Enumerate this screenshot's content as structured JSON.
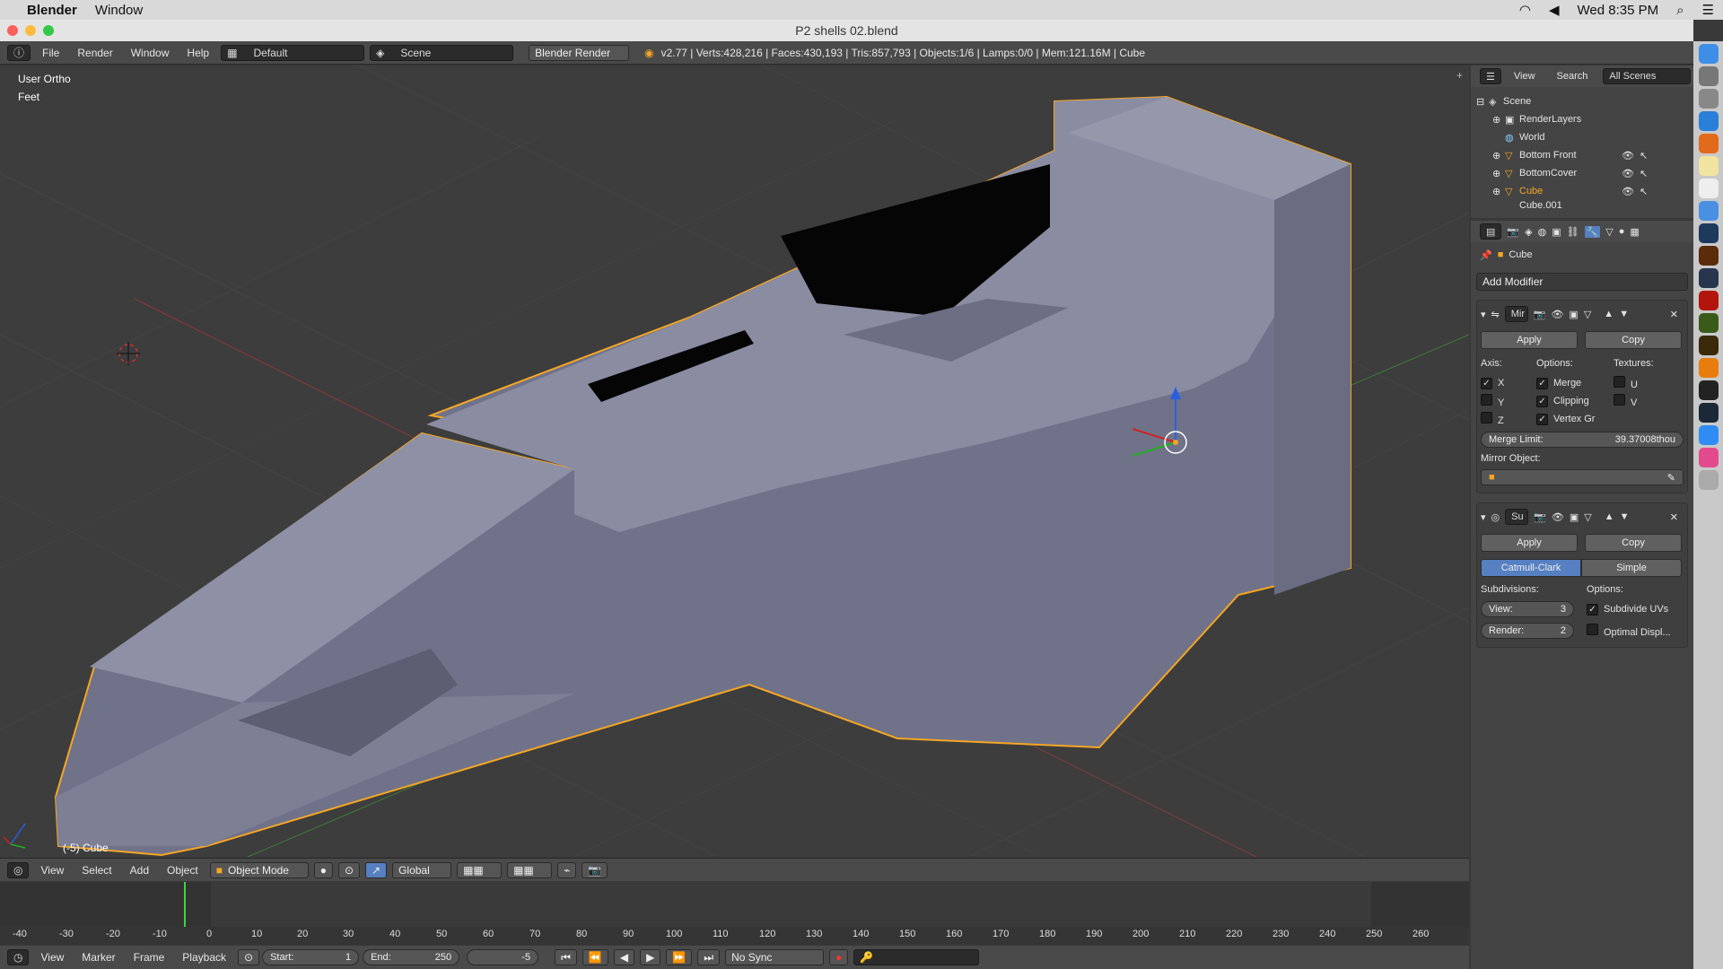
{
  "mac_menubar": {
    "app": "Blender",
    "menu_window": "Window",
    "clock": "Wed 8:35 PM"
  },
  "window": {
    "title": "P2 shells 02.blend"
  },
  "info_header": {
    "menus": [
      "File",
      "Render",
      "Window",
      "Help"
    ],
    "layout": "Default",
    "scene": "Scene",
    "engine": "Blender Render",
    "stats": "v2.77 | Verts:428,216 | Faces:430,193 | Tris:857,793 | Objects:1/6 | Lamps:0/0 | Mem:121.16M | Cube"
  },
  "viewport": {
    "view_name": "User Ortho",
    "units": "Feet",
    "object_label": "(-5) Cube"
  },
  "outliner": {
    "header": {
      "view": "View",
      "search": "Search",
      "scope": "All Scenes"
    },
    "items": [
      {
        "label": "Scene",
        "indent": 0
      },
      {
        "label": "RenderLayers",
        "indent": 1
      },
      {
        "label": "World",
        "indent": 1
      },
      {
        "label": "Bottom Front",
        "indent": 1
      },
      {
        "label": "BottomCover",
        "indent": 1
      },
      {
        "label": "Cube",
        "indent": 1
      },
      {
        "label": "Cube.001",
        "indent": 1
      }
    ]
  },
  "properties": {
    "context_object": "Cube",
    "add_modifier": "Add Modifier",
    "mirror": {
      "name": "Mir",
      "apply": "Apply",
      "copy": "Copy",
      "axis_label": "Axis:",
      "options_label": "Options:",
      "textures_label": "Textures:",
      "axes": [
        {
          "label": "X",
          "checked": true
        },
        {
          "label": "Y",
          "checked": false
        },
        {
          "label": "Z",
          "checked": false
        }
      ],
      "options": [
        {
          "label": "Merge",
          "checked": true
        },
        {
          "label": "Clipping",
          "checked": true
        },
        {
          "label": "Vertex Gr",
          "checked": true
        }
      ],
      "textures": [
        {
          "label": "U",
          "checked": false
        },
        {
          "label": "V",
          "checked": false
        }
      ],
      "merge_limit_label": "Merge Limit:",
      "merge_limit_value": "39.37008thou",
      "mirror_object_label": "Mirror Object:"
    },
    "subsurf": {
      "name": "Su",
      "apply": "Apply",
      "copy": "Copy",
      "mode_a": "Catmull-Clark",
      "mode_b": "Simple",
      "subdivisions_label": "Subdivisions:",
      "options_label": "Options:",
      "view_label": "View:",
      "view_value": "3",
      "render_label": "Render:",
      "render_value": "2",
      "subdivide_uvs": "Subdivide UVs",
      "optimal_display": "Optimal Displ..."
    }
  },
  "view3d_header": {
    "menus": [
      "View",
      "Select",
      "Add",
      "Object"
    ],
    "mode": "Object Mode",
    "orientation": "Global"
  },
  "timeline": {
    "ticks": [
      "-40",
      "-30",
      "-20",
      "-10",
      "0",
      "10",
      "20",
      "30",
      "40",
      "50",
      "60",
      "70",
      "80",
      "90",
      "100",
      "110",
      "120",
      "130",
      "140",
      "150",
      "160",
      "170",
      "180",
      "190",
      "200",
      "210",
      "220",
      "230",
      "240",
      "250",
      "260"
    ],
    "menus": [
      "View",
      "Marker",
      "Frame",
      "Playback"
    ],
    "start_label": "Start:",
    "start_value": "1",
    "end_label": "End:",
    "end_value": "250",
    "current_frame": "-5",
    "sync": "No Sync"
  },
  "colors": {
    "selection_outline": "#f5a623",
    "mesh": "#7b7d93",
    "active_tab": "#5680c2"
  }
}
